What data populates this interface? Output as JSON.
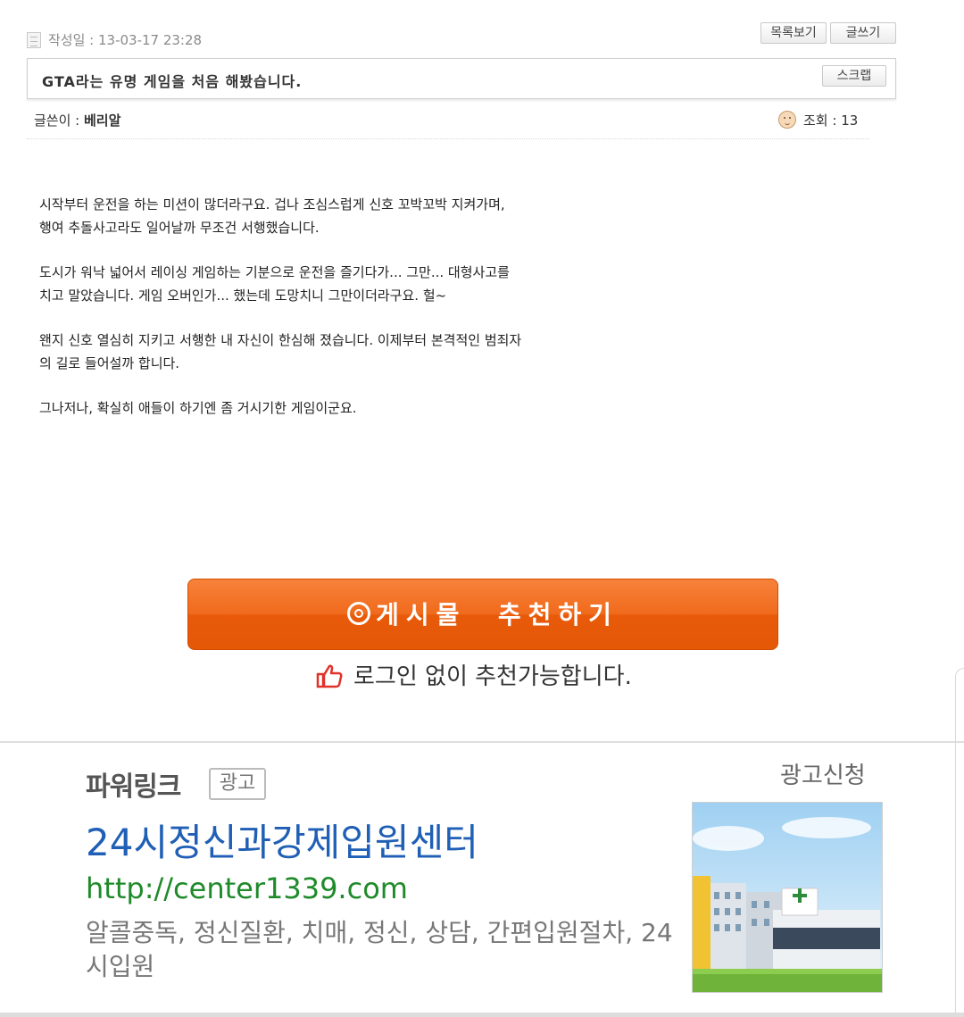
{
  "post": {
    "date_label": "작성일 : 13-03-17 23:28",
    "buttons": {
      "list": "목록보기",
      "write": "글쓰기",
      "scrap": "스크랩"
    },
    "title": "GTA라는 유명 게임을 처음 해봤습니다.",
    "author_label": "글쓴이 : ",
    "author_name": "베리알",
    "views_label": "조회 : 13",
    "paragraphs": [
      "시작부터 운전을 하는 미션이 많더라구요. 겁나 조심스럽게 신호 꼬박꼬박 지켜가며,\n행여 추돌사고라도 일어날까 무조건 서행했습니다.",
      "도시가 워낙 넓어서 레이싱 게임하는 기분으로 운전을 즐기다가... 그만... 대형사고를\n치고 말았습니다. 게임 오버인가... 했는데 도망치니 그만이더라구요. 헐~",
      "왠지 신호 열심히 지키고 서행한 내 자신이 한심해 졌습니다. 이제부터 본격적인 범죄자\n의 길로 들어설까 합니다.",
      "그나저나, 확실히 애들이 하기엔 좀 거시기한 게임이군요."
    ]
  },
  "recommend": {
    "button_label": "게시물  추천하기",
    "note": "로그인 없이 추천가능합니다."
  },
  "ad": {
    "section_title": "파워링크",
    "badge": "광고",
    "apply_link": "광고신청",
    "title": "24시정신과강제입원센터",
    "url": "http://center1339.com",
    "description": "알콜중독, 정신질환, 치매, 정신, 상담, 간편입원절차, 24시입원"
  },
  "colors": {
    "recommend_orange": "#f06a1c",
    "ad_title_blue": "#1f5fb5",
    "ad_url_green": "#1e8a2a"
  }
}
